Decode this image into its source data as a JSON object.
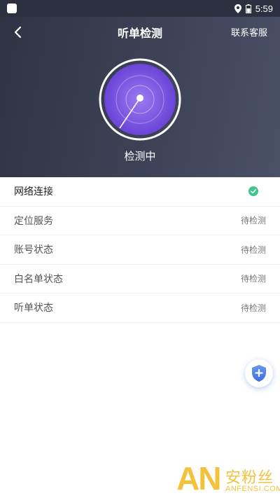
{
  "status_bar": {
    "time": "5:59",
    "icons": [
      "app-icon",
      "location-icon",
      "battery-icon"
    ]
  },
  "header": {
    "title": "听单检测",
    "contact": "联系客服",
    "back_icon": "back-arrow-icon",
    "radar_status": "检测中"
  },
  "checks": [
    {
      "label": "网络连接",
      "status": "",
      "state": "done"
    },
    {
      "label": "定位服务",
      "status": "待检测",
      "state": "pending"
    },
    {
      "label": "账号状态",
      "status": "待检测",
      "state": "pending"
    },
    {
      "label": "白名单状态",
      "status": "待检测",
      "state": "pending"
    },
    {
      "label": "听单状态",
      "status": "待检测",
      "state": "pending"
    }
  ],
  "fab": {
    "icon": "shield-plus-icon"
  },
  "watermark": {
    "logo": "AN",
    "brand": "安粉丝",
    "url": "ANFENSI.COM"
  },
  "colors": {
    "header_bg": "#3d4256",
    "radar_purple": "#7a52e0",
    "ok_green": "#3fc48a",
    "fab_blue": "#4f7ee6",
    "watermark": "#f0b81c"
  }
}
